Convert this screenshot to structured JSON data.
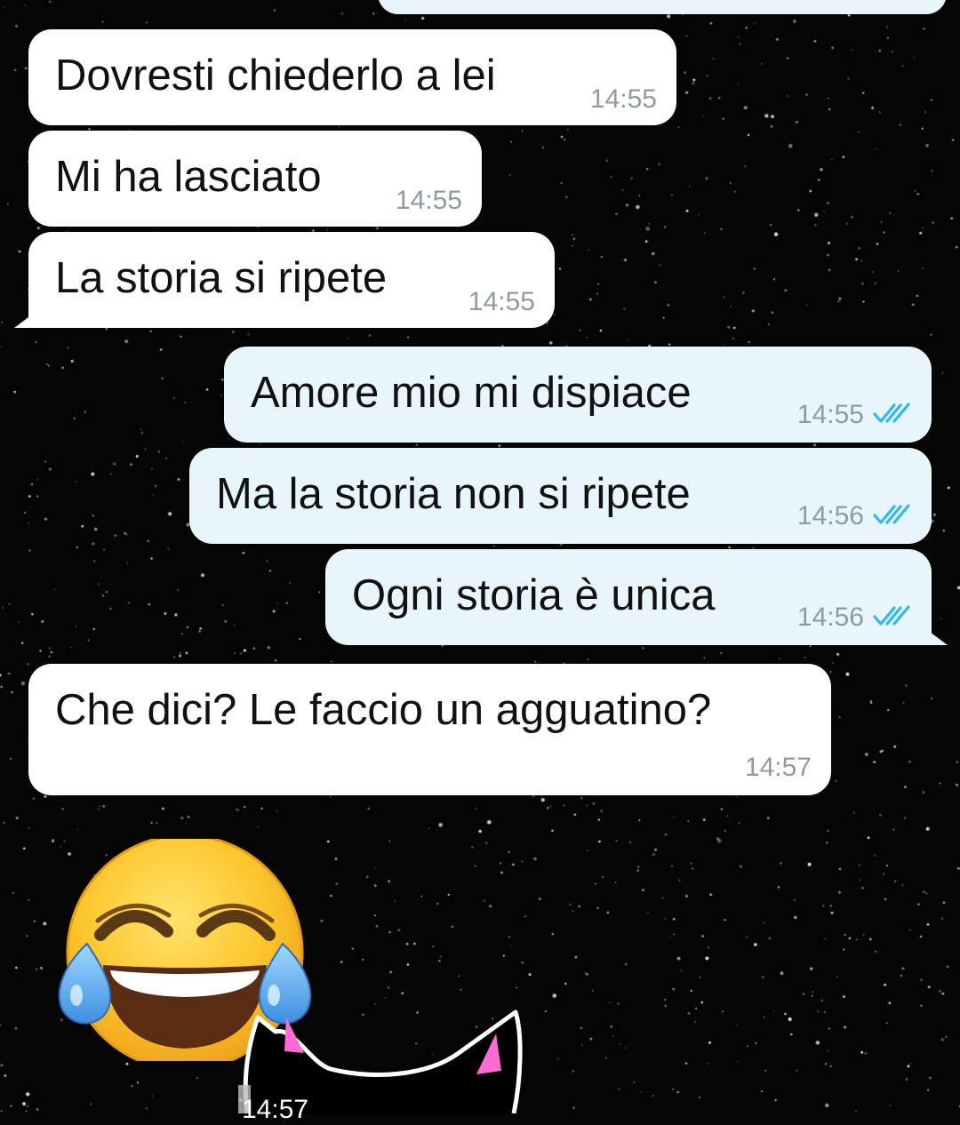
{
  "chat": {
    "messages": [
      {
        "text": "Dovresti chiederlo a lei",
        "time": "14:55",
        "direction": "in"
      },
      {
        "text": "Mi ha lasciato",
        "time": "14:55",
        "direction": "in"
      },
      {
        "text": "La storia si ripete",
        "time": "14:55",
        "direction": "in"
      },
      {
        "text": "Amore mio mi dispiace",
        "time": "14:55",
        "direction": "out",
        "status": "read-ticks-icon"
      },
      {
        "text": "Ma la storia non si ripete",
        "time": "14:56",
        "direction": "out",
        "status": "read-ticks-icon"
      },
      {
        "text": "Ogni storia è unica",
        "time": "14:56",
        "direction": "out",
        "status": "read-ticks-icon"
      },
      {
        "text": "Che dici? Le faccio un agguatino?",
        "time": "14:57",
        "direction": "in"
      }
    ],
    "emoji_message": {
      "icon": "face-with-tears-of-joy-icon"
    },
    "sticker_message": {
      "icon": "cat-sticker-icon",
      "time": "14:57"
    }
  },
  "colors": {
    "background": "#050505",
    "incoming_bubble": "#ffffff",
    "outgoing_bubble": "#e8f6fb",
    "timestamp": "#8f9aa3",
    "read_ticks": "#34b7f1"
  }
}
